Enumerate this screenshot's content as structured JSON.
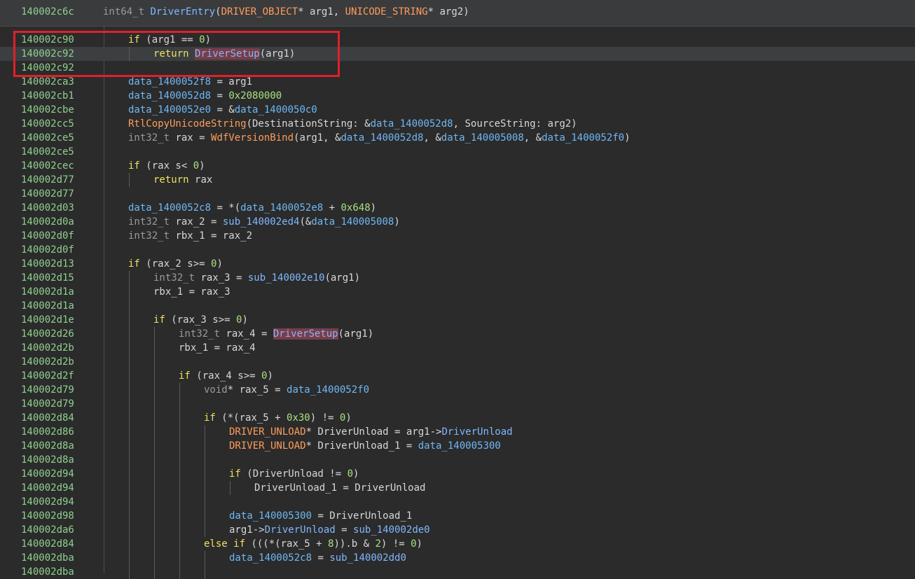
{
  "colors": {
    "background": "#2b2b2b",
    "address": "#8fd18f",
    "keyword": "#f0e060",
    "function": "#7fb8ff",
    "number": "#a6e37f",
    "type_name": "#ff9d5c",
    "highlight_box": "#e0202a"
  },
  "header": {
    "address": "140002c6c",
    "signature": [
      {
        "t": "int64_t ",
        "c": "type"
      },
      {
        "t": "DriverEntry",
        "c": "fn"
      },
      {
        "t": "(",
        "c": "op"
      },
      {
        "t": "DRIVER_OBJECT",
        "c": "tyname"
      },
      {
        "t": "* arg1, ",
        "c": "op"
      },
      {
        "t": "UNICODE_STRING",
        "c": "tyname"
      },
      {
        "t": "* arg2)",
        "c": "op"
      }
    ]
  },
  "lines": [
    {
      "addr": "140002c90",
      "indent": 0,
      "tokens": [
        {
          "t": "if",
          "c": "kw"
        },
        {
          "t": " (arg1 == ",
          "c": "op"
        },
        {
          "t": "0",
          "c": "num"
        },
        {
          "t": ")",
          "c": "op"
        }
      ]
    },
    {
      "addr": "140002c92",
      "indent": 1,
      "hl": true,
      "tokens": [
        {
          "t": "return ",
          "c": "kw"
        },
        {
          "t": "DriverSetup",
          "c": "sel"
        },
        {
          "t": "(arg1)",
          "c": "op"
        }
      ]
    },
    {
      "addr": "140002c92",
      "indent": 0,
      "tokens": []
    },
    {
      "addr": "140002ca3",
      "indent": 0,
      "tokens": [
        {
          "t": "data_1400052f8",
          "c": "gv"
        },
        {
          "t": " = arg1",
          "c": "op"
        }
      ]
    },
    {
      "addr": "140002cb1",
      "indent": 0,
      "tokens": [
        {
          "t": "data_1400052d8",
          "c": "gv"
        },
        {
          "t": " = ",
          "c": "op"
        },
        {
          "t": "0x2080000",
          "c": "num"
        }
      ]
    },
    {
      "addr": "140002cbe",
      "indent": 0,
      "tokens": [
        {
          "t": "data_1400052e0",
          "c": "gv"
        },
        {
          "t": " = &",
          "c": "op"
        },
        {
          "t": "data_1400050c0",
          "c": "gv"
        }
      ]
    },
    {
      "addr": "140002cc5",
      "indent": 0,
      "tokens": [
        {
          "t": "RtlCopyUnicodeString",
          "c": "tyname"
        },
        {
          "t": "(DestinationString: &",
          "c": "op"
        },
        {
          "t": "data_1400052d8",
          "c": "gv"
        },
        {
          "t": ", SourceString: arg2)",
          "c": "op"
        }
      ]
    },
    {
      "addr": "140002ce5",
      "indent": 0,
      "tokens": [
        {
          "t": "int32_t ",
          "c": "type"
        },
        {
          "t": "rax = ",
          "c": "op"
        },
        {
          "t": "WdfVersionBind",
          "c": "tyname"
        },
        {
          "t": "(arg1, &",
          "c": "op"
        },
        {
          "t": "data_1400052d8",
          "c": "gv"
        },
        {
          "t": ", &",
          "c": "op"
        },
        {
          "t": "data_140005008",
          "c": "gv"
        },
        {
          "t": ", &",
          "c": "op"
        },
        {
          "t": "data_1400052f0",
          "c": "gv"
        },
        {
          "t": ")",
          "c": "op"
        }
      ]
    },
    {
      "addr": "140002ce5",
      "indent": 0,
      "tokens": []
    },
    {
      "addr": "140002cec",
      "indent": 0,
      "tokens": [
        {
          "t": "if",
          "c": "kw"
        },
        {
          "t": " (rax s< ",
          "c": "op"
        },
        {
          "t": "0",
          "c": "num"
        },
        {
          "t": ")",
          "c": "op"
        }
      ]
    },
    {
      "addr": "140002d77",
      "indent": 1,
      "tokens": [
        {
          "t": "return ",
          "c": "kw"
        },
        {
          "t": "rax",
          "c": "op"
        }
      ]
    },
    {
      "addr": "140002d77",
      "indent": 0,
      "tokens": []
    },
    {
      "addr": "140002d03",
      "indent": 0,
      "tokens": [
        {
          "t": "data_1400052c8",
          "c": "gv"
        },
        {
          "t": " = *(",
          "c": "op"
        },
        {
          "t": "data_1400052e8",
          "c": "gv"
        },
        {
          "t": " + ",
          "c": "op"
        },
        {
          "t": "0x648",
          "c": "num"
        },
        {
          "t": ")",
          "c": "op"
        }
      ]
    },
    {
      "addr": "140002d0a",
      "indent": 0,
      "tokens": [
        {
          "t": "int32_t ",
          "c": "type"
        },
        {
          "t": "rax_2 = ",
          "c": "op"
        },
        {
          "t": "sub_140002ed4",
          "c": "fn"
        },
        {
          "t": "(&",
          "c": "op"
        },
        {
          "t": "data_140005008",
          "c": "gv"
        },
        {
          "t": ")",
          "c": "op"
        }
      ]
    },
    {
      "addr": "140002d0f",
      "indent": 0,
      "tokens": [
        {
          "t": "int32_t ",
          "c": "type"
        },
        {
          "t": "rbx_1 = rax_2",
          "c": "op"
        }
      ]
    },
    {
      "addr": "140002d0f",
      "indent": 0,
      "tokens": []
    },
    {
      "addr": "140002d13",
      "indent": 0,
      "tokens": [
        {
          "t": "if",
          "c": "kw"
        },
        {
          "t": " (rax_2 s>= ",
          "c": "op"
        },
        {
          "t": "0",
          "c": "num"
        },
        {
          "t": ")",
          "c": "op"
        }
      ]
    },
    {
      "addr": "140002d15",
      "indent": 1,
      "tokens": [
        {
          "t": "int32_t ",
          "c": "type"
        },
        {
          "t": "rax_3 = ",
          "c": "op"
        },
        {
          "t": "sub_140002e10",
          "c": "fn"
        },
        {
          "t": "(arg1)",
          "c": "op"
        }
      ]
    },
    {
      "addr": "140002d1a",
      "indent": 1,
      "tokens": [
        {
          "t": "rbx_1 = rax_3",
          "c": "op"
        }
      ]
    },
    {
      "addr": "140002d1a",
      "indent": 1,
      "tokens": []
    },
    {
      "addr": "140002d1e",
      "indent": 1,
      "tokens": [
        {
          "t": "if",
          "c": "kw"
        },
        {
          "t": " (rax_3 s>= ",
          "c": "op"
        },
        {
          "t": "0",
          "c": "num"
        },
        {
          "t": ")",
          "c": "op"
        }
      ]
    },
    {
      "addr": "140002d26",
      "indent": 2,
      "tokens": [
        {
          "t": "int32_t ",
          "c": "type"
        },
        {
          "t": "rax_4 = ",
          "c": "op"
        },
        {
          "t": "DriverSetup",
          "c": "sel"
        },
        {
          "t": "(arg1)",
          "c": "op"
        }
      ]
    },
    {
      "addr": "140002d2b",
      "indent": 2,
      "tokens": [
        {
          "t": "rbx_1 = rax_4",
          "c": "op"
        }
      ]
    },
    {
      "addr": "140002d2b",
      "indent": 2,
      "tokens": []
    },
    {
      "addr": "140002d2f",
      "indent": 2,
      "tokens": [
        {
          "t": "if",
          "c": "kw"
        },
        {
          "t": " (rax_4 s>= ",
          "c": "op"
        },
        {
          "t": "0",
          "c": "num"
        },
        {
          "t": ")",
          "c": "op"
        }
      ]
    },
    {
      "addr": "140002d79",
      "indent": 3,
      "tokens": [
        {
          "t": "void",
          "c": "type"
        },
        {
          "t": "* rax_5 = ",
          "c": "op"
        },
        {
          "t": "data_1400052f0",
          "c": "gv"
        }
      ]
    },
    {
      "addr": "140002d79",
      "indent": 3,
      "tokens": []
    },
    {
      "addr": "140002d84",
      "indent": 3,
      "tokens": [
        {
          "t": "if",
          "c": "kw"
        },
        {
          "t": " (*(rax_5 + ",
          "c": "op"
        },
        {
          "t": "0x30",
          "c": "num"
        },
        {
          "t": ") != ",
          "c": "op"
        },
        {
          "t": "0",
          "c": "num"
        },
        {
          "t": ")",
          "c": "op"
        }
      ]
    },
    {
      "addr": "140002d86",
      "indent": 4,
      "tokens": [
        {
          "t": "DRIVER_UNLOAD",
          "c": "tyname"
        },
        {
          "t": "* DriverUnload = arg1->",
          "c": "op"
        },
        {
          "t": "DriverUnload",
          "c": "fn"
        }
      ]
    },
    {
      "addr": "140002d8a",
      "indent": 4,
      "tokens": [
        {
          "t": "DRIVER_UNLOAD",
          "c": "tyname"
        },
        {
          "t": "* DriverUnload_1 = ",
          "c": "op"
        },
        {
          "t": "data_140005300",
          "c": "gv"
        }
      ]
    },
    {
      "addr": "140002d8a",
      "indent": 4,
      "tokens": []
    },
    {
      "addr": "140002d94",
      "indent": 4,
      "tokens": [
        {
          "t": "if",
          "c": "kw"
        },
        {
          "t": " (DriverUnload != ",
          "c": "op"
        },
        {
          "t": "0",
          "c": "num"
        },
        {
          "t": ")",
          "c": "op"
        }
      ]
    },
    {
      "addr": "140002d94",
      "indent": 5,
      "tokens": [
        {
          "t": "DriverUnload_1 = DriverUnload",
          "c": "op"
        }
      ]
    },
    {
      "addr": "140002d94",
      "indent": 4,
      "tokens": []
    },
    {
      "addr": "140002d98",
      "indent": 4,
      "tokens": [
        {
          "t": "data_140005300",
          "c": "gv"
        },
        {
          "t": " = DriverUnload_1",
          "c": "op"
        }
      ]
    },
    {
      "addr": "140002da6",
      "indent": 4,
      "tokens": [
        {
          "t": "arg1->",
          "c": "op"
        },
        {
          "t": "DriverUnload",
          "c": "fn"
        },
        {
          "t": " = ",
          "c": "op"
        },
        {
          "t": "sub_140002de0",
          "c": "fn"
        }
      ]
    },
    {
      "addr": "140002d84",
      "indent": 3,
      "tokens": [
        {
          "t": "else if",
          "c": "kw"
        },
        {
          "t": " (((*(rax_5 + ",
          "c": "op"
        },
        {
          "t": "8",
          "c": "num"
        },
        {
          "t": ")).b & ",
          "c": "op"
        },
        {
          "t": "2",
          "c": "num"
        },
        {
          "t": ") != ",
          "c": "op"
        },
        {
          "t": "0",
          "c": "num"
        },
        {
          "t": ")",
          "c": "op"
        }
      ]
    },
    {
      "addr": "140002dba",
      "indent": 4,
      "tokens": [
        {
          "t": "data_1400052c8",
          "c": "gv"
        },
        {
          "t": " = ",
          "c": "op"
        },
        {
          "t": "sub_140002dd0",
          "c": "fn"
        }
      ]
    },
    {
      "addr": "140002dba",
      "indent": 4,
      "tokens": []
    }
  ]
}
